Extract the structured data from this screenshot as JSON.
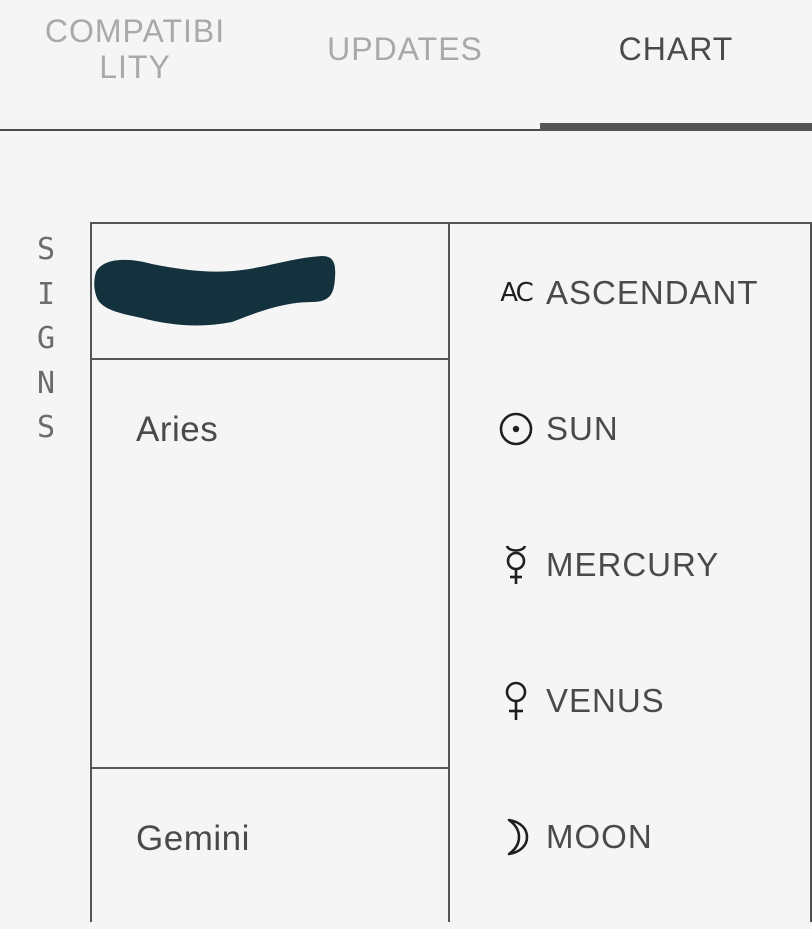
{
  "tabs": [
    {
      "label_line1": "COMPATIBI",
      "label_line2": "LITY",
      "active": false
    },
    {
      "label": "UPDATES",
      "active": false
    },
    {
      "label": "CHART",
      "active": true
    }
  ],
  "section_label": [
    "S",
    "I",
    "G",
    "N",
    "S"
  ],
  "signs": [
    {
      "name": "Aries"
    },
    {
      "name": "Gemini"
    }
  ],
  "planets": [
    {
      "icon": "ascendant-icon",
      "symbol": "AC",
      "label": "ASCENDANT"
    },
    {
      "icon": "sun-icon",
      "label": "SUN"
    },
    {
      "icon": "mercury-icon",
      "label": "MERCURY"
    },
    {
      "icon": "venus-icon",
      "label": "VENUS"
    },
    {
      "icon": "moon-icon",
      "label": "MOON"
    }
  ],
  "colors": {
    "background": "#f4f5f4",
    "text": "#4a4a4a",
    "inactive_tab": "#a9a9a9",
    "redaction": "#14323d"
  }
}
